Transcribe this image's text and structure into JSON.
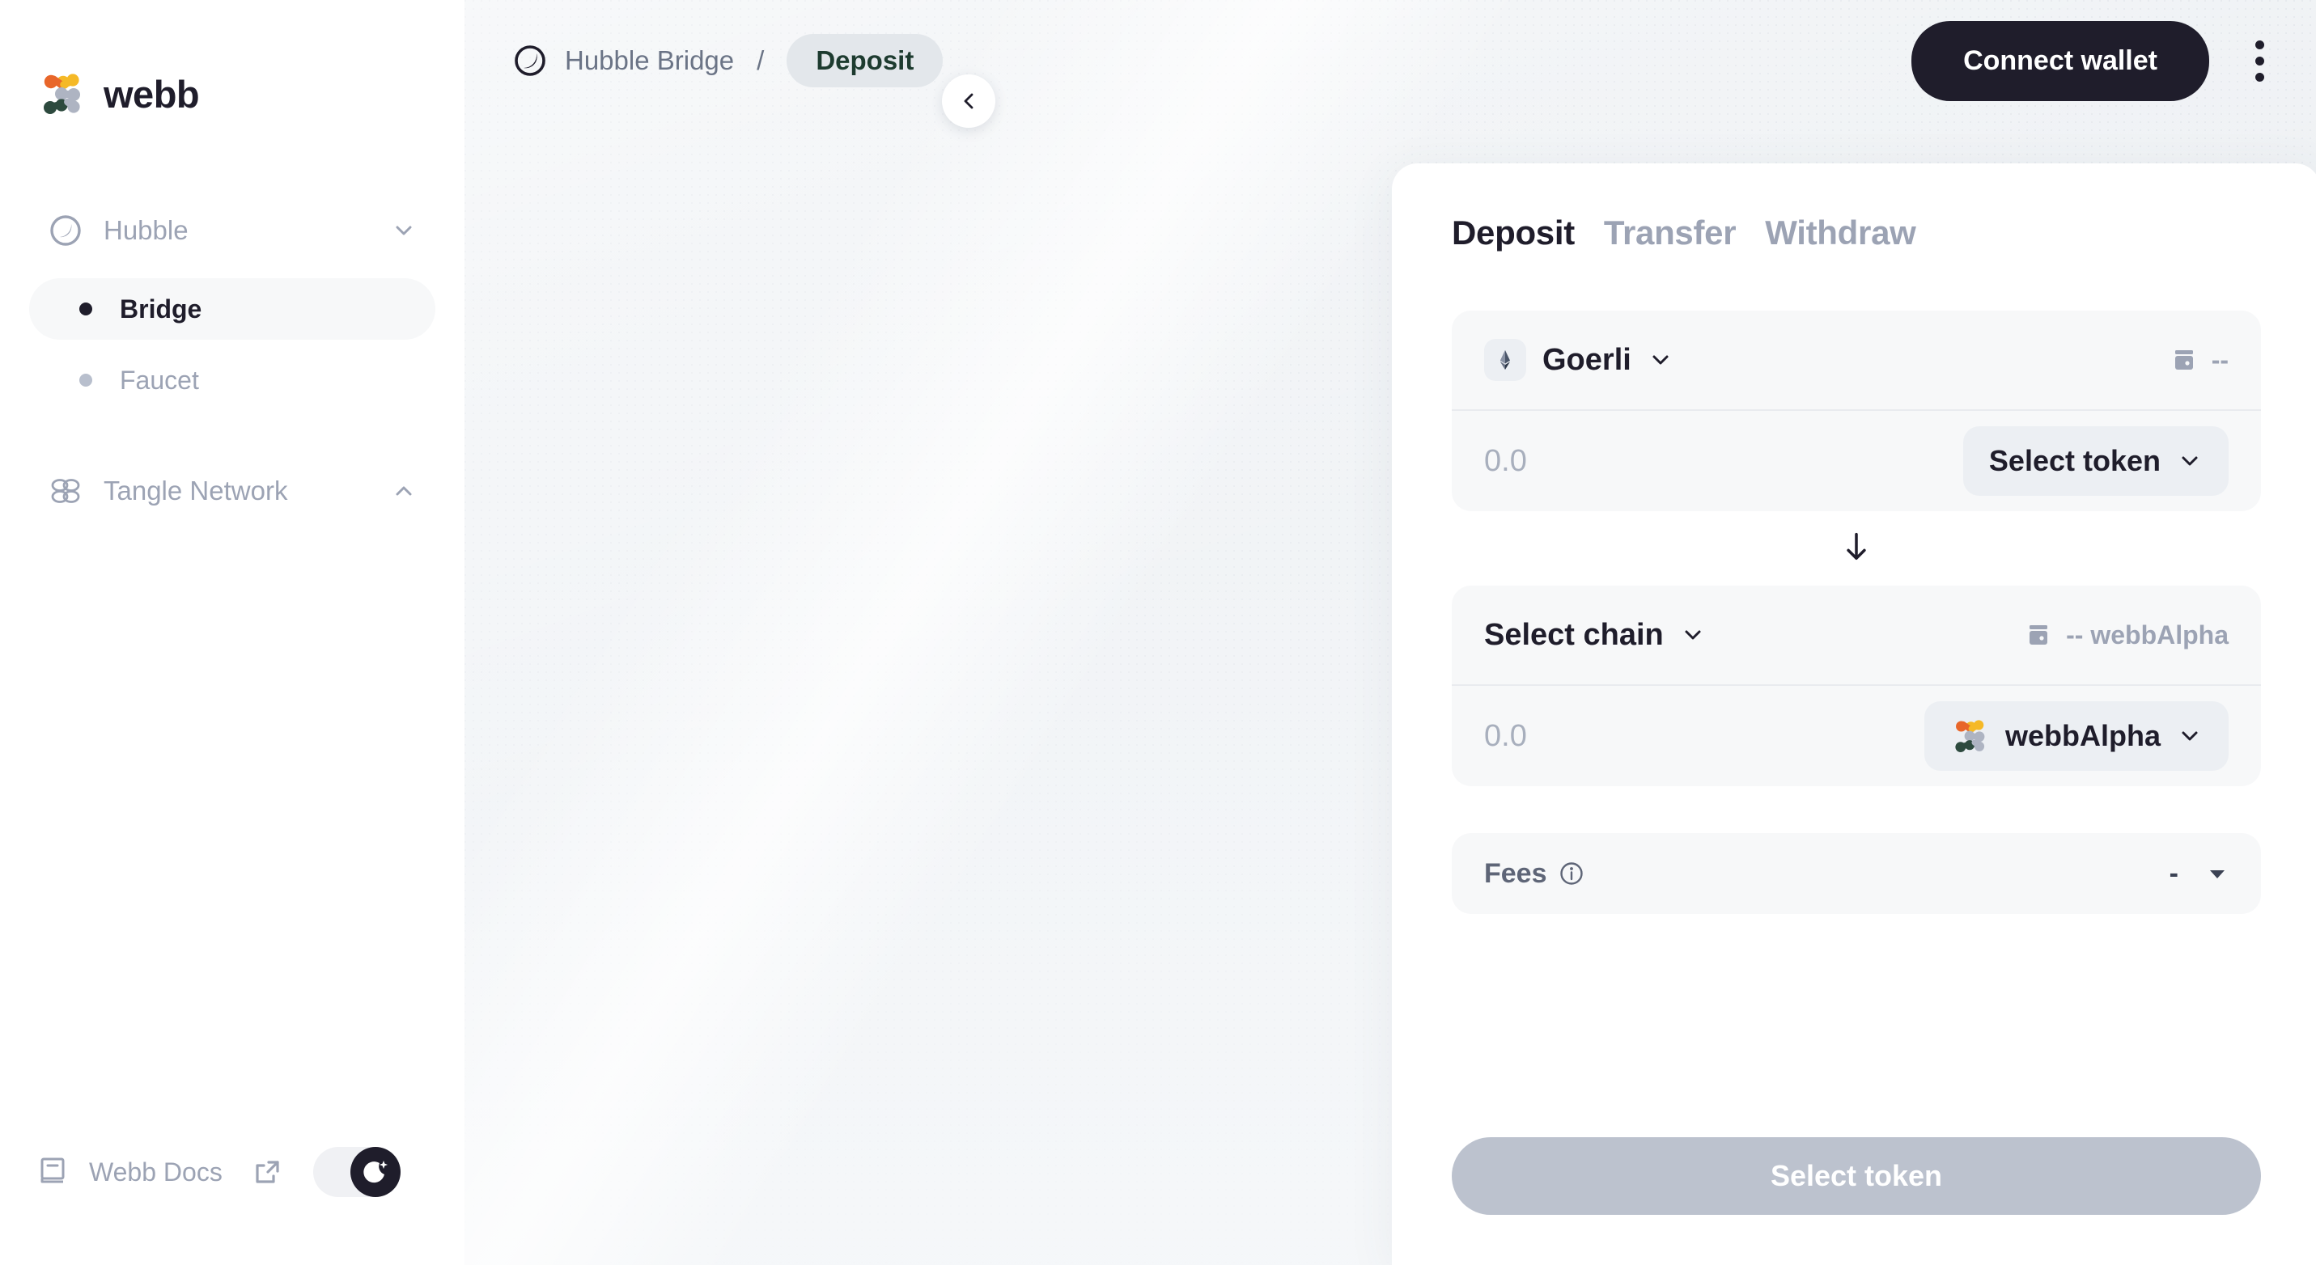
{
  "brand": {
    "name": "webb",
    "logo_icon": "webb-logo-icon"
  },
  "sidebar": {
    "groups": [
      {
        "label": "Hubble",
        "icon": "moon-circle-icon",
        "chevron": "chevron-down-icon",
        "expanded": true,
        "items": [
          {
            "label": "Bridge",
            "active": true
          },
          {
            "label": "Faucet",
            "active": false
          }
        ]
      },
      {
        "label": "Tangle Network",
        "icon": "tangle-knot-icon",
        "chevron": "chevron-up-icon",
        "expanded": false,
        "items": []
      }
    ],
    "footer": {
      "docs_label": "Webb Docs",
      "docs_icon": "book-icon",
      "external_icon": "external-link-icon",
      "theme_toggle": {
        "state": "dark",
        "icon": "moon-stars-icon"
      }
    }
  },
  "topbar": {
    "breadcrumb": {
      "icon": "moon-circle-icon",
      "root": "Hubble Bridge",
      "separator": "/",
      "current": "Deposit"
    },
    "connect_wallet_label": "Connect wallet",
    "kebab_icon": "more-vertical-icon",
    "collapse_icon": "chevron-left-icon"
  },
  "bridge": {
    "tabs": [
      {
        "label": "Deposit",
        "active": true
      },
      {
        "label": "Transfer",
        "active": false
      },
      {
        "label": "Withdraw",
        "active": false
      }
    ],
    "source": {
      "chain_name": "Goerli",
      "chain_icon": "ethereum-icon",
      "chevron": "chevron-down-icon",
      "wallet_icon": "wallet-icon",
      "balance": "--",
      "amount_value": "",
      "amount_placeholder": "0.0",
      "token_label": "Select token",
      "token_icon": null,
      "token_chevron": "chevron-down-icon"
    },
    "swap_arrow_icon": "arrow-down-icon",
    "destination": {
      "chain_name": "Select chain",
      "chevron": "chevron-down-icon",
      "wallet_icon": "wallet-icon",
      "balance": "-- webbAlpha",
      "amount_value": "",
      "amount_placeholder": "0.0",
      "token_label": "webbAlpha",
      "token_icon": "webb-logo-icon",
      "token_chevron": "chevron-down-icon"
    },
    "fees": {
      "label": "Fees",
      "info_icon": "info-icon",
      "value": "-",
      "caret_icon": "caret-down-icon"
    },
    "action_label": "Select token",
    "action_disabled": true
  },
  "colors": {
    "dark": "#1f1d2b",
    "muted": "#9ca3b4",
    "surface": "#f7f8f9",
    "canvas": "#eef1f4",
    "chip": "#eceff3",
    "accent_green": "#1d3b2f",
    "disabled": "#bcc2ce"
  }
}
